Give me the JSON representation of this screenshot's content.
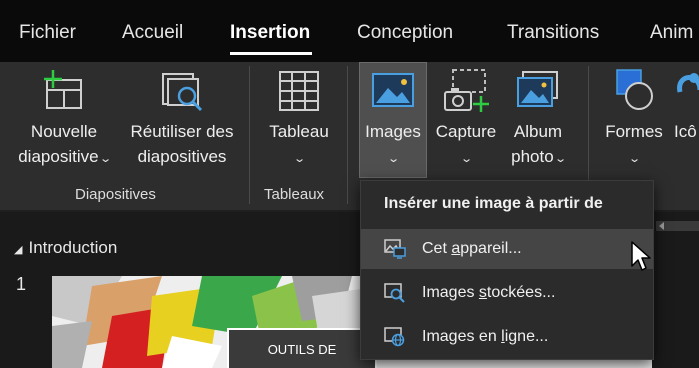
{
  "tabs": [
    {
      "label": "Fichier",
      "active": false
    },
    {
      "label": "Accueil",
      "active": false
    },
    {
      "label": "Insertion",
      "active": true
    },
    {
      "label": "Conception",
      "active": false
    },
    {
      "label": "Transitions",
      "active": false
    },
    {
      "label": "Anim",
      "active": false
    }
  ],
  "ribbon": {
    "nouvelle_diapositive": {
      "line1": "Nouvelle",
      "line2": "diapositive",
      "icon": "new-slide-icon"
    },
    "reutiliser": {
      "line1": "Réutiliser des",
      "line2": "diapositives",
      "icon": "reuse-slides-icon"
    },
    "tableau": {
      "line1": "Tableau",
      "icon": "table-icon"
    },
    "images": {
      "line1": "Images",
      "icon": "images-icon"
    },
    "capture": {
      "line1": "Capture",
      "icon": "screenshot-icon"
    },
    "album": {
      "line1": "Album",
      "line2": "photo",
      "icon": "photo-album-icon"
    },
    "formes": {
      "line1": "Formes",
      "icon": "shapes-icon"
    },
    "icones": {
      "line1": "Icô",
      "icon": "icons-icon"
    },
    "groups": {
      "diapositives": "Diapositives",
      "tableaux": "Tableaux"
    }
  },
  "outline": {
    "section_title": "Introduction",
    "slide_number": "1",
    "thumbnail_text": "OUTILS DE"
  },
  "dropdown": {
    "header": "Insérer une image à partir de",
    "items": [
      {
        "pre": "Cet ",
        "u": "a",
        "post": "ppareil...",
        "icon": "this-device-icon",
        "hover": true
      },
      {
        "pre": "Images ",
        "u": "s",
        "post": "tockées...",
        "icon": "stock-images-icon",
        "hover": false
      },
      {
        "pre": "Images en ",
        "u": "l",
        "post": "igne...",
        "icon": "online-images-icon",
        "hover": false
      }
    ]
  },
  "colors": {
    "accent_green": "#2ecc40",
    "icon_blue": "#4a9fe0",
    "background": "#1f1f1f"
  }
}
